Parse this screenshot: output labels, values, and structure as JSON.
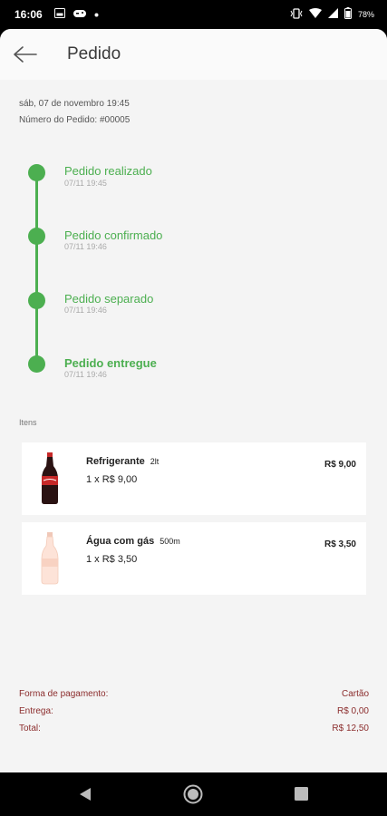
{
  "status_bar": {
    "time": "16:06",
    "battery": "78%",
    "left_icons": [
      "gallery-icon",
      "game-icon",
      "dot-icon"
    ],
    "right_icons": [
      "vibrate-icon",
      "wifi-icon",
      "signal-icon",
      "battery-icon"
    ]
  },
  "header": {
    "title": "Pedido",
    "back_icon": "arrow-left-icon"
  },
  "order": {
    "date": "sáb, 07 de novembro 19:45",
    "number": "Número do Pedido: #00005"
  },
  "timeline": [
    {
      "title": "Pedido realizado",
      "time": "07/11 19:45"
    },
    {
      "title": "Pedido confirmado",
      "time": "07/11 19:46"
    },
    {
      "title": "Pedido separado",
      "time": "07/11 19:46"
    },
    {
      "title": "Pedido entregue",
      "time": "07/11 19:46"
    }
  ],
  "items_label": "Itens",
  "items": [
    {
      "name": "Refrigerante",
      "size": "2lt",
      "qty": "1 x R$ 9,00",
      "price": "R$ 9,00"
    },
    {
      "name": "Água com gás",
      "size": "500m",
      "qty": "1 x R$ 3,50",
      "price": "R$ 3,50"
    }
  ],
  "payment": {
    "method_label": "Forma de pagamento:",
    "method_value": "Cartão",
    "delivery_label": "Entrega:",
    "delivery_value": "R$ 0,00",
    "total_label": "Total:",
    "total_value": "R$ 12,50"
  },
  "colors": {
    "accent_green": "#4caf50",
    "payment_text": "#8b2c2c"
  }
}
